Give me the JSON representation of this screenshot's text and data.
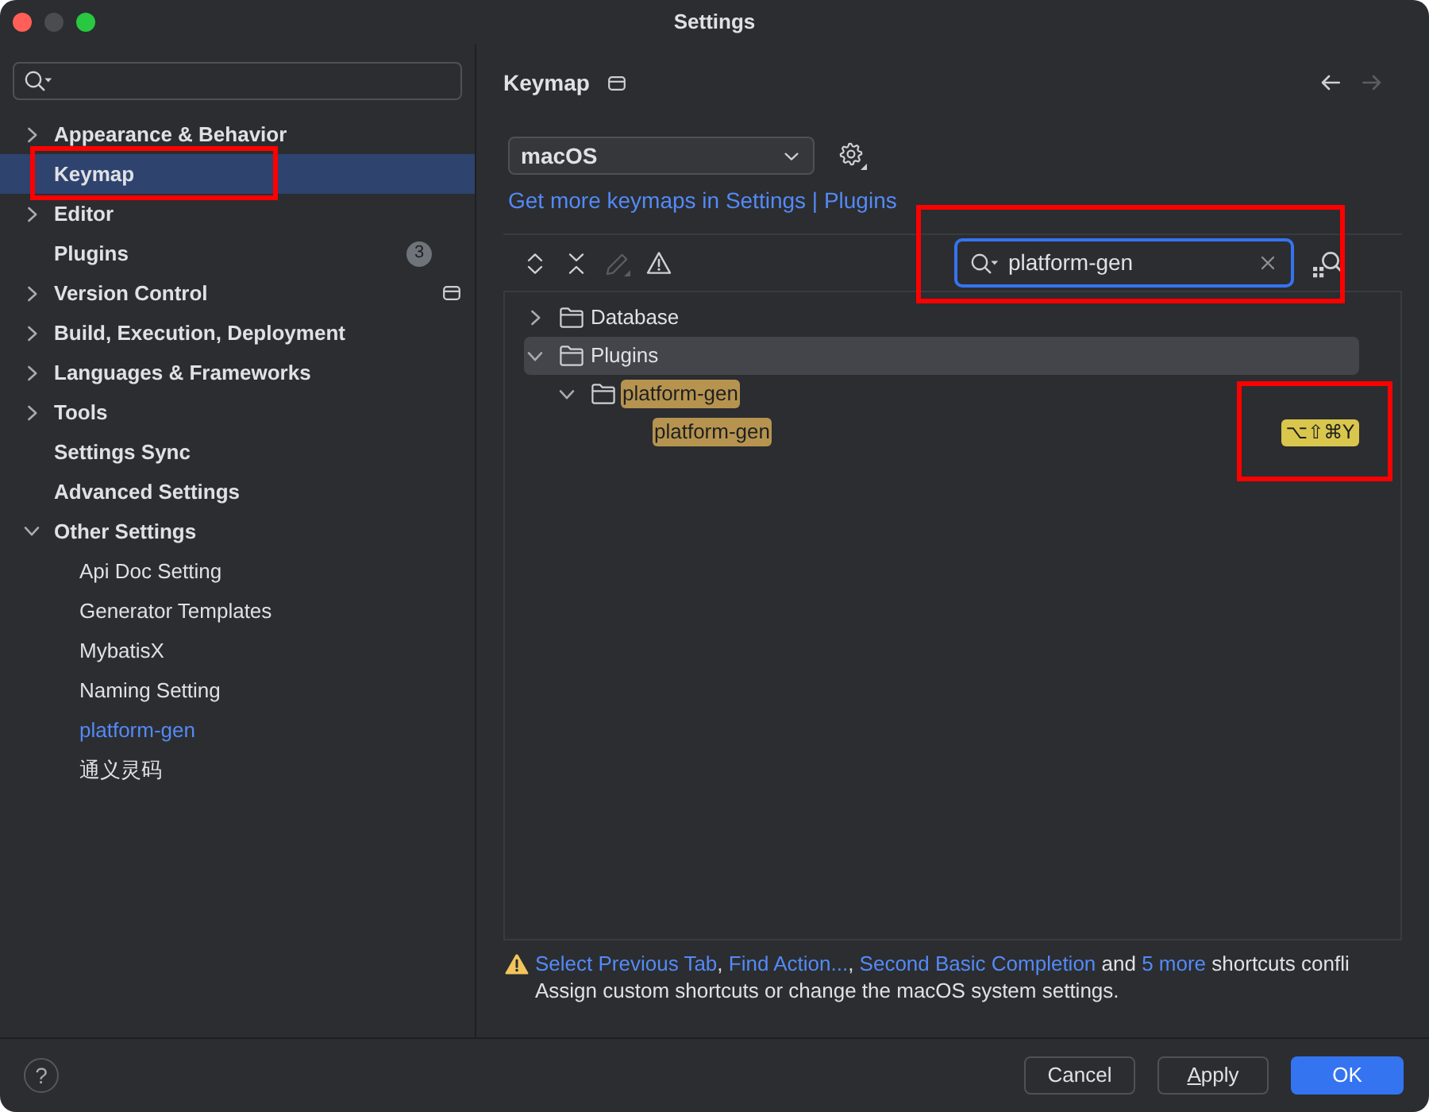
{
  "window": {
    "title": "Settings",
    "controls": [
      {
        "kind": "close",
        "disabled": false
      },
      {
        "kind": "minimize",
        "disabled": true
      },
      {
        "kind": "zoom",
        "disabled": false
      }
    ]
  },
  "sidebar": {
    "items": [
      {
        "label": "Appearance & Behavior",
        "expanded": false,
        "selected": false
      },
      {
        "label": "Keymap",
        "selected": true,
        "annotated": true
      },
      {
        "label": "Editor",
        "expanded": false,
        "selected": false
      },
      {
        "label": "Plugins",
        "selected": false,
        "badge": "3"
      },
      {
        "label": "Version Control",
        "expanded": false,
        "selected": false,
        "project_level": true
      },
      {
        "label": "Build, Execution, Deployment",
        "expanded": false,
        "selected": false
      },
      {
        "label": "Languages & Frameworks",
        "expanded": false,
        "selected": false
      },
      {
        "label": "Tools",
        "expanded": false,
        "selected": false
      },
      {
        "label": "Settings Sync",
        "selected": false
      },
      {
        "label": "Advanced Settings",
        "selected": false
      },
      {
        "label": "Other Settings",
        "expanded": true,
        "selected": false,
        "children": [
          {
            "label": "Api Doc Setting",
            "selected": false
          },
          {
            "label": "Generator Templates",
            "selected": false
          },
          {
            "label": "MybatisX",
            "selected": false
          },
          {
            "label": "Naming Setting",
            "selected": false
          },
          {
            "label": "platform-gen",
            "selected": false,
            "modified": true
          },
          {
            "label": "通义灵码",
            "selected": false
          }
        ]
      }
    ]
  },
  "page": {
    "title": "Keymap",
    "project_level": true,
    "navigation": [
      {
        "kind": "back",
        "disabled": false
      },
      {
        "kind": "forward",
        "disabled": true
      }
    ],
    "keymap_select": {
      "value": "macOS"
    },
    "keymaps_link": "Get more keymaps in Settings | Plugins",
    "toolbar": [
      {
        "kind": "expand_all",
        "disabled": false
      },
      {
        "kind": "collapse_all",
        "disabled": false
      },
      {
        "kind": "edit",
        "disabled": true
      },
      {
        "kind": "conflicts",
        "disabled": false
      }
    ],
    "action_search": {
      "value": "platform-gen",
      "focused": true,
      "annotated": true
    },
    "tree": [
      {
        "label": "Database",
        "kind": "folder",
        "expanded": false,
        "selected": false,
        "match": false
      },
      {
        "label": "Plugins",
        "kind": "folder",
        "expanded": true,
        "selected": true,
        "match": false,
        "children": [
          {
            "label": "platform-gen",
            "kind": "folder",
            "expanded": true,
            "selected": false,
            "match": true,
            "children": [
              {
                "label": "platform-gen",
                "kind": "action",
                "selected": false,
                "match": true,
                "shortcut": "⌥⇧⌘Y",
                "annotated": true
              }
            ]
          }
        ]
      }
    ],
    "conflict_warning": {
      "parts": [
        {
          "kind": "link",
          "text": "Select Previous Tab"
        },
        {
          "kind": "text",
          "text": ", "
        },
        {
          "kind": "link",
          "text": "Find Action..."
        },
        {
          "kind": "text",
          "text": ", "
        },
        {
          "kind": "link",
          "text": "Second Basic Completion"
        },
        {
          "kind": "text",
          "text": " and "
        },
        {
          "kind": "link",
          "text": "5 more"
        },
        {
          "kind": "text",
          "text": " shortcuts confli"
        }
      ],
      "hint": "Assign custom shortcuts or change the macOS system settings."
    }
  },
  "footer": {
    "help": "?",
    "buttons": [
      {
        "label": "Cancel",
        "default": false,
        "mnemonic": false
      },
      {
        "label": "Apply",
        "default": false,
        "mnemonic": true
      },
      {
        "label": "OK",
        "default": true,
        "mnemonic": false
      }
    ]
  }
}
